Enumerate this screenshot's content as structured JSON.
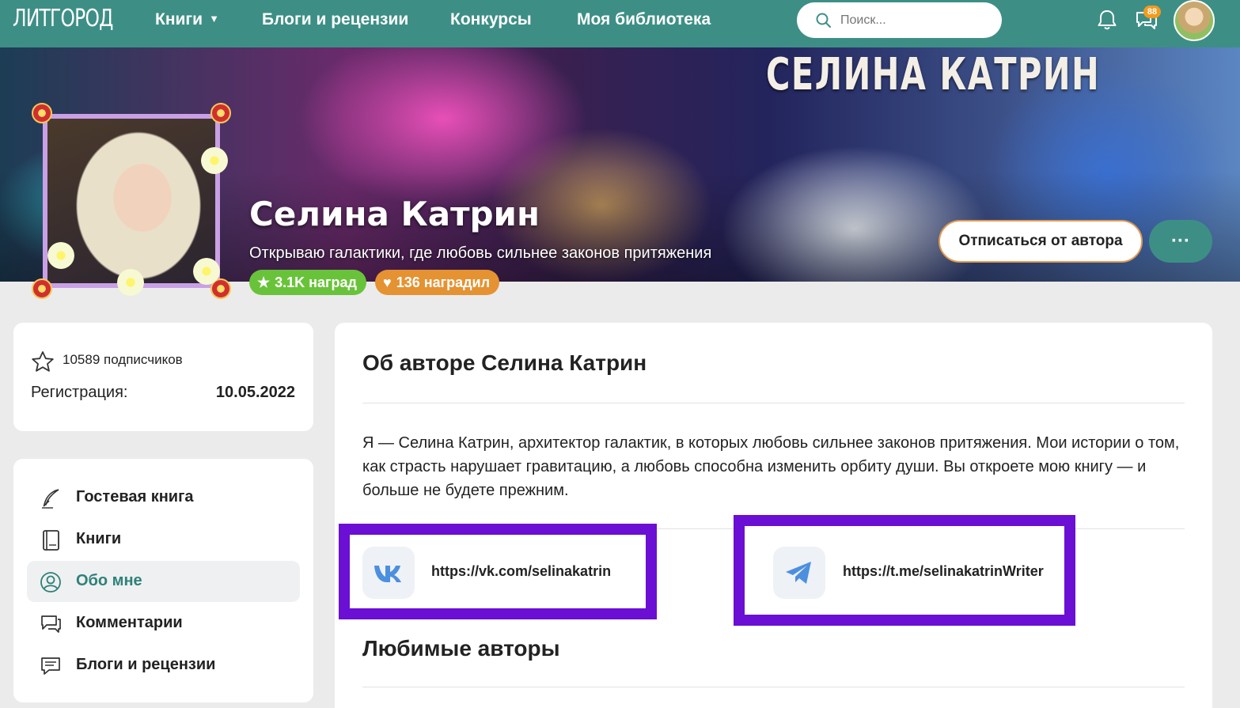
{
  "header": {
    "logo": "ЛИТГОРОД",
    "nav": {
      "books": "Книги",
      "blogs": "Блоги и рецензии",
      "contests": "Конкурсы",
      "library": "Моя библиотека"
    },
    "search_placeholder": "Поиск...",
    "messages_badge": "88",
    "accent_color": "#3d8f86"
  },
  "banner": {
    "title": "СЕЛИНА КАТРИН"
  },
  "author": {
    "name": "Селина Катрин",
    "tagline": "Открываю галактики, где любовь сильнее законов притяжения",
    "awards_badge": "3.1K наград",
    "given_badge": "136 наградил",
    "unsubscribe_label": "Отписаться от автора",
    "more_label": "···"
  },
  "stats": {
    "subscribers": "10589 подписчиков",
    "registration_label": "Регистрация:",
    "registration_date": "10.05.2022"
  },
  "menu": {
    "items": [
      {
        "label": "Гостевая книга",
        "icon": "quill-icon",
        "active": false
      },
      {
        "label": "Книги",
        "icon": "book-icon",
        "active": false
      },
      {
        "label": "Обо мне",
        "icon": "user-icon",
        "active": true
      },
      {
        "label": "Комментарии",
        "icon": "comments-icon",
        "active": false
      },
      {
        "label": "Блоги и рецензии",
        "icon": "blog-icon",
        "active": false
      }
    ]
  },
  "about": {
    "title": "Об авторе Селина Катрин",
    "text": "Я — Селина Катрин, архитектор галактик, в которых любовь сильнее законов притяжения. Мои истории о том, как страсть нарушает гравитацию, а любовь способна изменить орбиту души. Вы откроете мою книгу — и больше не будете прежним.",
    "links": [
      {
        "url": "https://vk.com/selinakatrin",
        "icon": "vk-icon"
      },
      {
        "url": "https://t.me/selinakatrinWriter",
        "icon": "telegram-icon"
      }
    ],
    "favorites_title": "Любимые авторы"
  }
}
